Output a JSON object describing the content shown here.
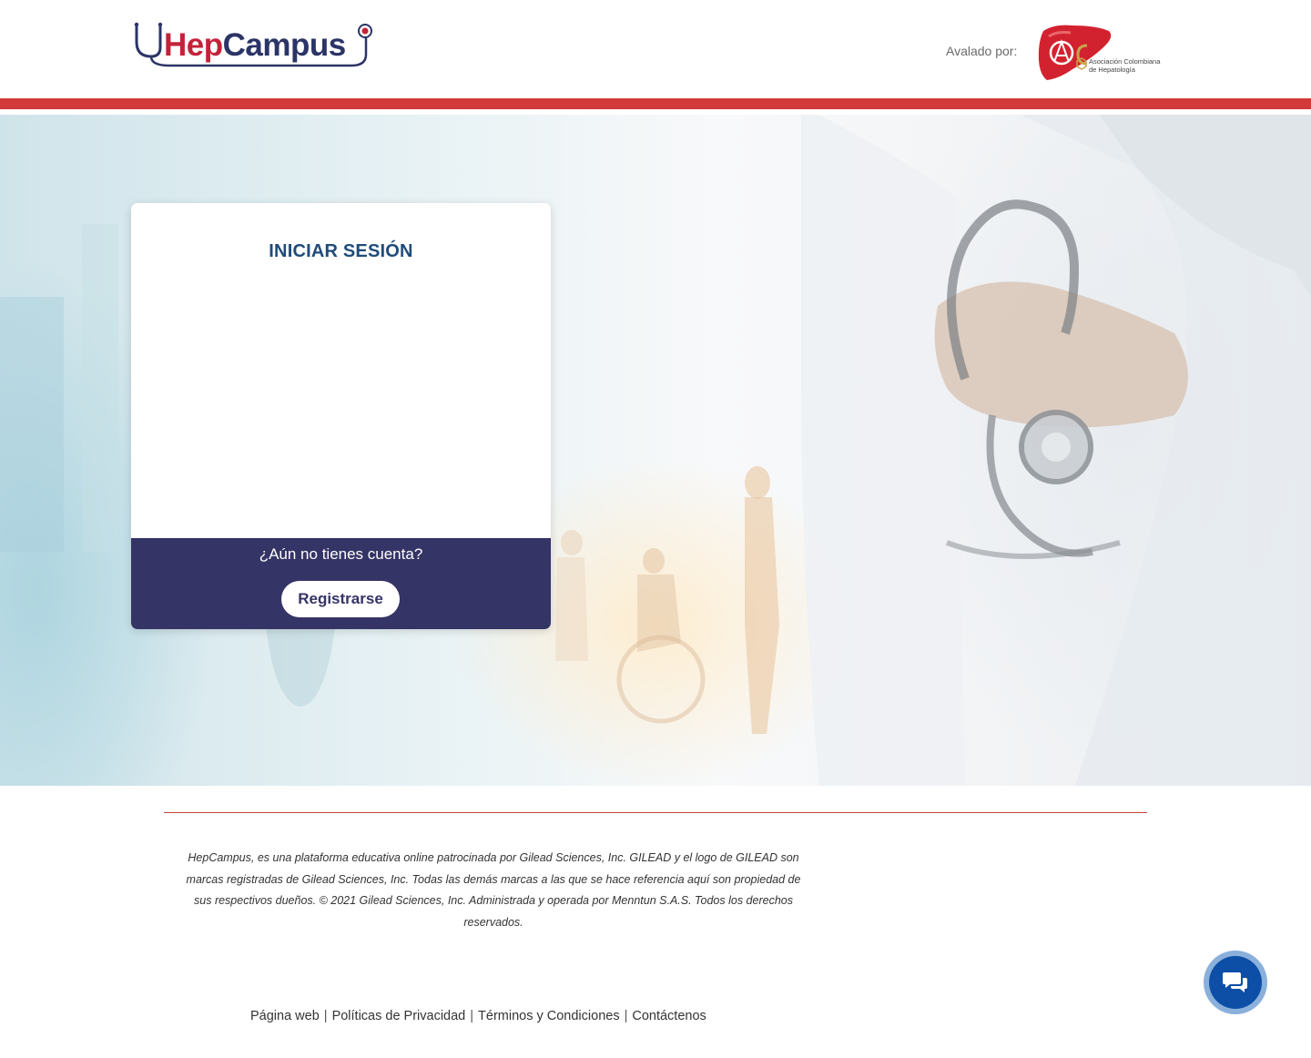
{
  "header": {
    "logo": {
      "part1": "Hep",
      "part2": "Campus"
    },
    "endorsed_by": "Avalado por:",
    "association": {
      "line1": "Asociación Colombiana",
      "line2": "de Hepatología"
    }
  },
  "login": {
    "title": "INICIAR SESIÓN",
    "no_account": "¿Aún no tienes cuenta?",
    "register_label": "Registrarse"
  },
  "footer": {
    "disclaimer": "HepCampus, es una plataforma educativa online patrocinada por Gilead Sciences, Inc. GILEAD y el logo de GILEAD son marcas registradas de Gilead Sciences, Inc. Todas las demás marcas a las que se hace referencia aquí son propiedad de sus respectivos dueños. © 2021 Gilead Sciences, Inc. Administrada y operada por Menntun S.A.S. Todos los derechos reservados.",
    "links": [
      "Página web",
      "Políticas de Privacidad",
      "Términos y Condiciones",
      "Contáctenos"
    ],
    "separator": "|"
  },
  "colors": {
    "brand_red": "#d23a3a",
    "brand_navy": "#353466",
    "title_blue": "#1f4b7a",
    "chat_blue": "#0d4ea6"
  },
  "icons": {
    "logo": "stethoscope-icon",
    "chat": "chat-bubbles-icon"
  }
}
